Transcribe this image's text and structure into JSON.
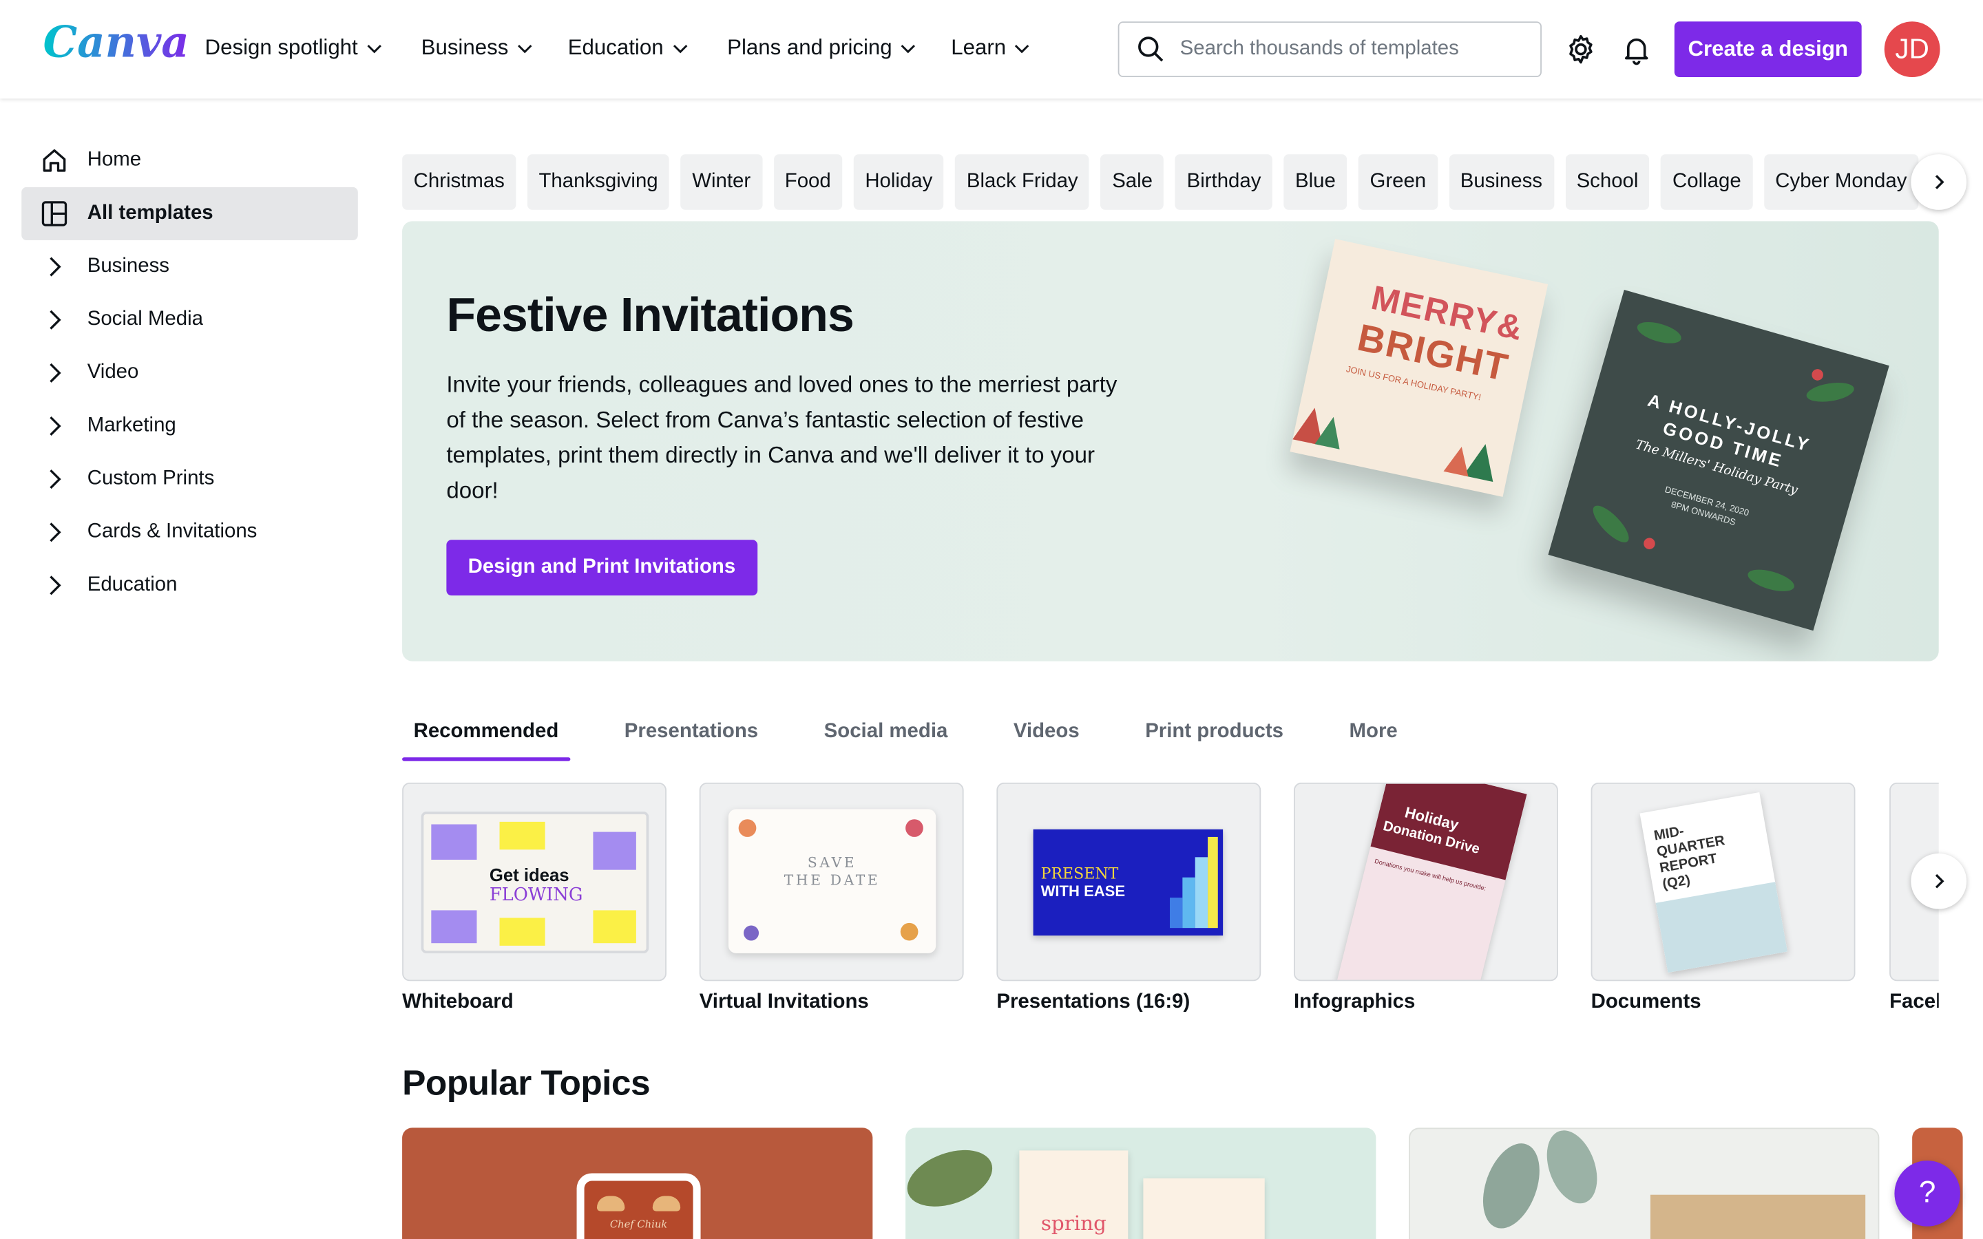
{
  "header": {
    "logo_text": "Canva",
    "nav": [
      {
        "label": "Design spotlight"
      },
      {
        "label": "Business"
      },
      {
        "label": "Education"
      },
      {
        "label": "Plans and pricing"
      },
      {
        "label": "Learn"
      }
    ],
    "search_placeholder": "Search thousands of templates",
    "create_label": "Create a design",
    "avatar_initials": "JD"
  },
  "sidebar": {
    "items": [
      {
        "label": "Home",
        "icon": "home-icon"
      },
      {
        "label": "All templates",
        "icon": "templates-icon",
        "active": true
      },
      {
        "label": "Business",
        "icon": "chevron-right-icon"
      },
      {
        "label": "Social Media",
        "icon": "chevron-right-icon"
      },
      {
        "label": "Video",
        "icon": "chevron-right-icon"
      },
      {
        "label": "Marketing",
        "icon": "chevron-right-icon"
      },
      {
        "label": "Custom Prints",
        "icon": "chevron-right-icon"
      },
      {
        "label": "Cards & Invitations",
        "icon": "chevron-right-icon"
      },
      {
        "label": "Education",
        "icon": "chevron-right-icon"
      }
    ]
  },
  "chips": [
    "Christmas",
    "Thanksgiving",
    "Winter",
    "Food",
    "Holiday",
    "Black Friday",
    "Sale",
    "Birthday",
    "Blue",
    "Green",
    "Business",
    "School",
    "Collage",
    "Cyber Monday"
  ],
  "hero": {
    "title": "Festive Invitations",
    "body": "Invite your friends, colleagues and loved ones to the merriest party of the season. Select from Canva’s fantastic selection of festive templates, print them directly in Canva and we'll deliver it to your door!",
    "cta": "Design and Print Invitations",
    "card1": {
      "line1": "MERRY&",
      "line2": "BRIGHT",
      "sub": "JOIN US FOR A HOLIDAY PARTY!"
    },
    "card2": {
      "line1": "A HOLLY-JOLLY",
      "line2": "GOOD TIME",
      "script": "The Millers' Holiday Party",
      "date": "DECEMBER 24, 2020",
      "time": "8PM ONWARDS"
    }
  },
  "tabs": [
    {
      "label": "Recommended",
      "active": true
    },
    {
      "label": "Presentations"
    },
    {
      "label": "Social media"
    },
    {
      "label": "Videos"
    },
    {
      "label": "Print products"
    },
    {
      "label": "More"
    }
  ],
  "cards": [
    {
      "label": "Whiteboard",
      "thumb_text1": "Get ideas",
      "thumb_text2": "FLOWING"
    },
    {
      "label": "Virtual Invitations",
      "thumb_text1": "SAVE",
      "thumb_text2": "THE DATE"
    },
    {
      "label": "Presentations (16:9)",
      "thumb_text1": "PRESENT",
      "thumb_text2": "WITH EASE"
    },
    {
      "label": "Infographics",
      "thumb_text1": "Holiday",
      "thumb_text2": "Donation Drive",
      "thumb_text3": "Donations you make will help us provide:"
    },
    {
      "label": "Documents",
      "thumb_text1": "MID-",
      "thumb_text2": "QUARTER",
      "thumb_text3": "REPORT",
      "thumb_text4": "(Q2)"
    },
    {
      "label": "Facebook Post"
    }
  ],
  "popular_title": "Popular Topics",
  "topics": [
    {
      "script": "Chef Chiuk"
    },
    {
      "script": "spring"
    },
    {
      "script": ""
    }
  ],
  "help_label": "?",
  "colors": {
    "brand": "#7d2ae8",
    "accent": "#00c4cc",
    "avatar": "#e5484d"
  }
}
